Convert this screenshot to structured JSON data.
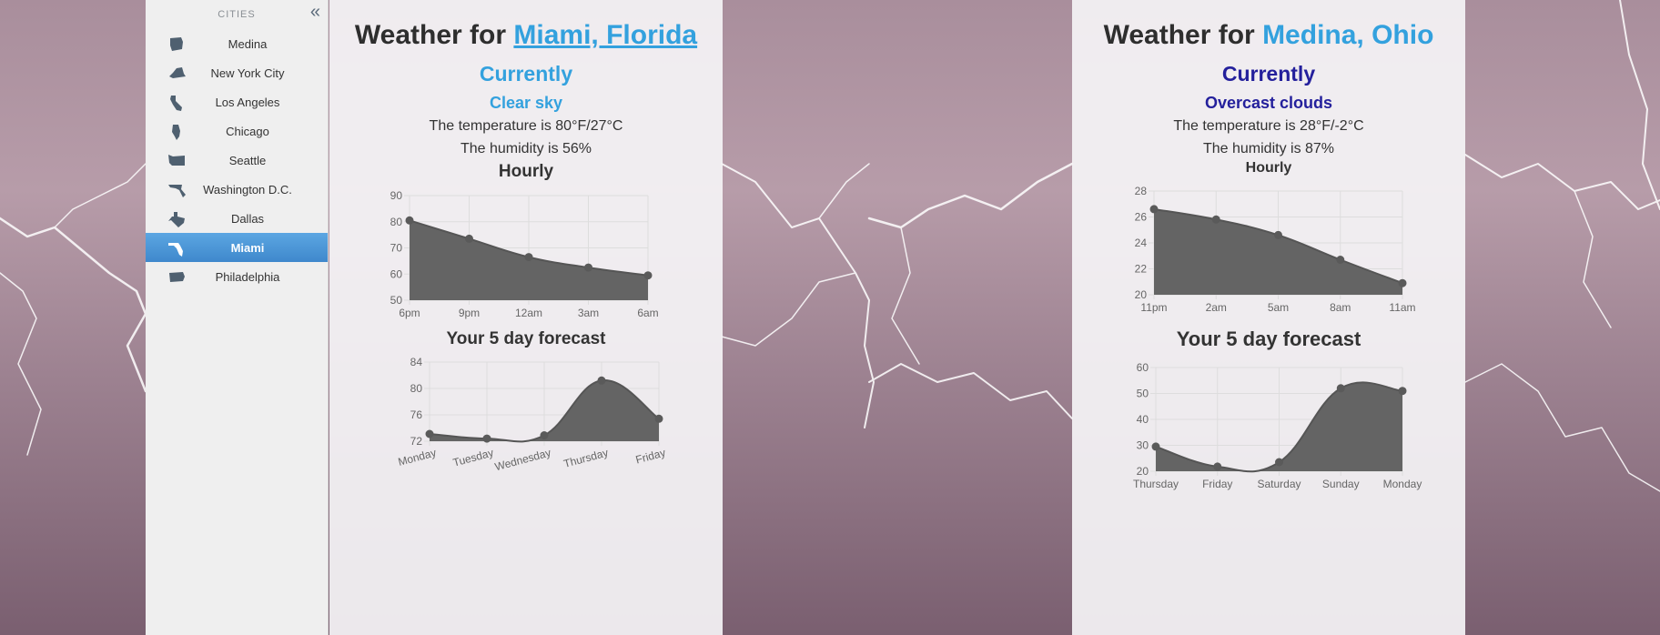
{
  "sidebar": {
    "title": "CITIES",
    "collapse_glyph": "«",
    "items": [
      {
        "label": "Medina",
        "icon": "ohio-state-icon"
      },
      {
        "label": "New York City",
        "icon": "new-york-state-icon"
      },
      {
        "label": "Los Angeles",
        "icon": "california-state-icon"
      },
      {
        "label": "Chicago",
        "icon": "illinois-state-icon"
      },
      {
        "label": "Seattle",
        "icon": "washington-state-icon"
      },
      {
        "label": "Washington D.C.",
        "icon": "maryland-state-icon"
      },
      {
        "label": "Dallas",
        "icon": "texas-state-icon"
      },
      {
        "label": "Miami",
        "icon": "florida-state-icon",
        "active": true
      },
      {
        "label": "Philadelphia",
        "icon": "pennsylvania-state-icon"
      }
    ]
  },
  "panels": [
    {
      "title_prefix": "Weather for ",
      "location": "Miami, Florida",
      "currently": "Currently",
      "condition": "Clear sky",
      "temperature_line": "The temperature is 80°F/27°C",
      "humidity_line": "The humidity is 56%",
      "hourly_title": "Hourly",
      "forecast_title": "Your 5 day forecast",
      "accent": "#33a1de"
    },
    {
      "title_prefix": "Weather for ",
      "location": "Medina, Ohio",
      "currently": "Currently",
      "condition": "Overcast clouds",
      "temperature_line": "The temperature is 28°F/-2°C",
      "humidity_line": "The humidity is 87%",
      "hourly_title": "Hourly",
      "forecast_title": "Your 5 day forecast",
      "accent": "#24209c"
    }
  ],
  "colors": {
    "chart_fill": "#646464",
    "grid": "#dddddd",
    "active_item": "#4a95d6"
  },
  "chart_data": [
    {
      "type": "area",
      "id": "miami-hourly",
      "categories": [
        "6pm",
        "9pm",
        "12am",
        "3am",
        "6am"
      ],
      "values": [
        80.5,
        73.5,
        66.5,
        62.5,
        59.5
      ],
      "ylim": [
        50,
        90
      ],
      "yticks": [
        50,
        60,
        70,
        80,
        90
      ]
    },
    {
      "type": "area",
      "id": "miami-forecast",
      "categories": [
        "Monday",
        "Tuesday",
        "Wednesday",
        "Thursday",
        "Friday"
      ],
      "values": [
        73.1,
        72.4,
        72.9,
        81.2,
        75.4
      ],
      "ylim": [
        72,
        84
      ],
      "yticks": [
        72,
        76,
        80,
        84
      ]
    },
    {
      "type": "area",
      "id": "medina-hourly",
      "categories": [
        "11pm",
        "2am",
        "5am",
        "8am",
        "11am"
      ],
      "values": [
        26.6,
        25.8,
        24.6,
        22.7,
        20.9
      ],
      "ylim": [
        20,
        28
      ],
      "yticks": [
        20,
        22,
        24,
        26,
        28
      ]
    },
    {
      "type": "area",
      "id": "medina-forecast",
      "categories": [
        "Thursday",
        "Friday",
        "Saturday",
        "Sunday",
        "Monday"
      ],
      "values": [
        29.5,
        21.8,
        23.5,
        52,
        51
      ],
      "ylim": [
        20,
        60
      ],
      "yticks": [
        20,
        30,
        40,
        50,
        60
      ]
    }
  ]
}
